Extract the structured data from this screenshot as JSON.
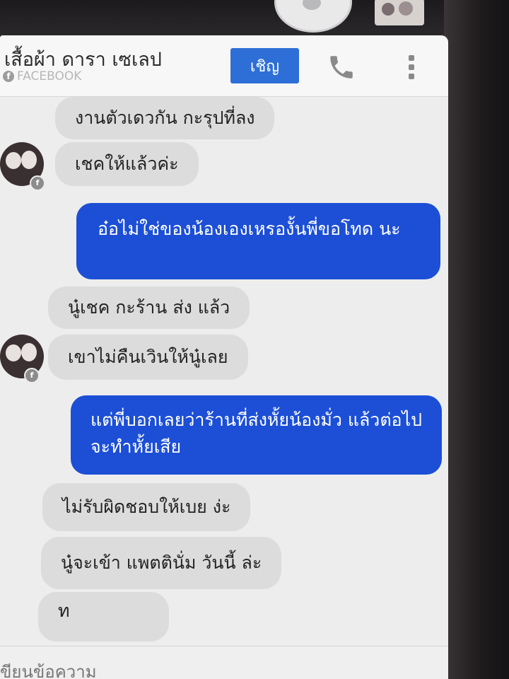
{
  "header": {
    "title": "เสื้อผ้า ดารา เซเลป",
    "source_label": "FACEBOOK",
    "invite_label": "เชิญ"
  },
  "icons": {
    "call": "phone-icon",
    "more": "more-vertical-icon",
    "source": "facebook-icon"
  },
  "messages": [
    {
      "side": "in",
      "text": "งานตัวเดวกัน กะรุปที่ลง"
    },
    {
      "side": "in",
      "text": "เชคให้แล้วค่ะ"
    },
    {
      "side": "out",
      "text": "อ๋อไม่ใช่ของน้องเองเหรองั้นพี่ขอโทด นะ"
    },
    {
      "side": "in",
      "text": "นู๋เชค กะร้าน ส่ง แล้ว"
    },
    {
      "side": "in",
      "text": "เขาไม่คืนเวินให้นู๋เลย"
    },
    {
      "side": "out",
      "text": "แต่พี่บอกเลยว่าร้านที่ส่งหั้ยน้องมั่ว แล้วต่อไปจะทำหั้ยเสีย"
    },
    {
      "side": "in",
      "text": "ไม่รับผิดชอบให้เบย ง่ะ"
    },
    {
      "side": "in",
      "text": "นู๋จะเข้า แพตตินั่ม วันนี้ ล่ะ"
    },
    {
      "side": "in",
      "text": "ท"
    }
  ],
  "composer": {
    "placeholder": "ขียนข้อความ"
  },
  "colors": {
    "outgoing_bubble": "#1c4fd6",
    "incoming_bubble": "#dcdcdc",
    "invite_button": "#2d6fd6"
  }
}
